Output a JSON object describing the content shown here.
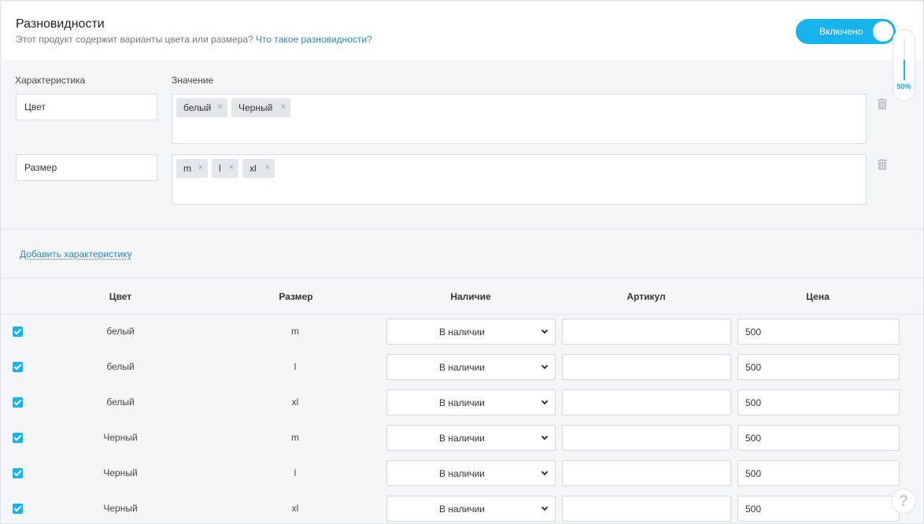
{
  "header": {
    "title": "Разновидности",
    "subtitle": "Этот продукт содержит варианты цвета или размера?",
    "help_link": "Что такое разновидности?",
    "toggle_label": "Включено"
  },
  "progress": {
    "value": 0.5,
    "label": "50%"
  },
  "labels": {
    "attribute": "Характеристика",
    "value": "Значение"
  },
  "attributes": [
    {
      "name": "Цвет",
      "values": [
        "белый",
        "Черный"
      ]
    },
    {
      "name": "Размер",
      "values": [
        "m",
        "l",
        "xl"
      ]
    }
  ],
  "chip_remove_glyph": "×",
  "add_link": "Добавить характеристику",
  "table": {
    "headers": [
      "Цвет",
      "Размер",
      "Наличие",
      "Артикул",
      "Цена"
    ],
    "rows": [
      {
        "color": "белый",
        "size": "m",
        "stock": "В наличии",
        "sku": "",
        "price": "500",
        "checked": true
      },
      {
        "color": "белый",
        "size": "l",
        "stock": "В наличии",
        "sku": "",
        "price": "500",
        "checked": true
      },
      {
        "color": "белый",
        "size": "xl",
        "stock": "В наличии",
        "sku": "",
        "price": "500",
        "checked": true
      },
      {
        "color": "Черный",
        "size": "m",
        "stock": "В наличии",
        "sku": "",
        "price": "500",
        "checked": true
      },
      {
        "color": "Черный",
        "size": "l",
        "stock": "В наличии",
        "sku": "",
        "price": "500",
        "checked": true
      },
      {
        "color": "Черный",
        "size": "xl",
        "stock": "В наличии",
        "sku": "",
        "price": "500",
        "checked": true
      }
    ]
  },
  "help_button": "?",
  "colors": {
    "accent": "#16b3ee",
    "link": "#2a87c8"
  }
}
